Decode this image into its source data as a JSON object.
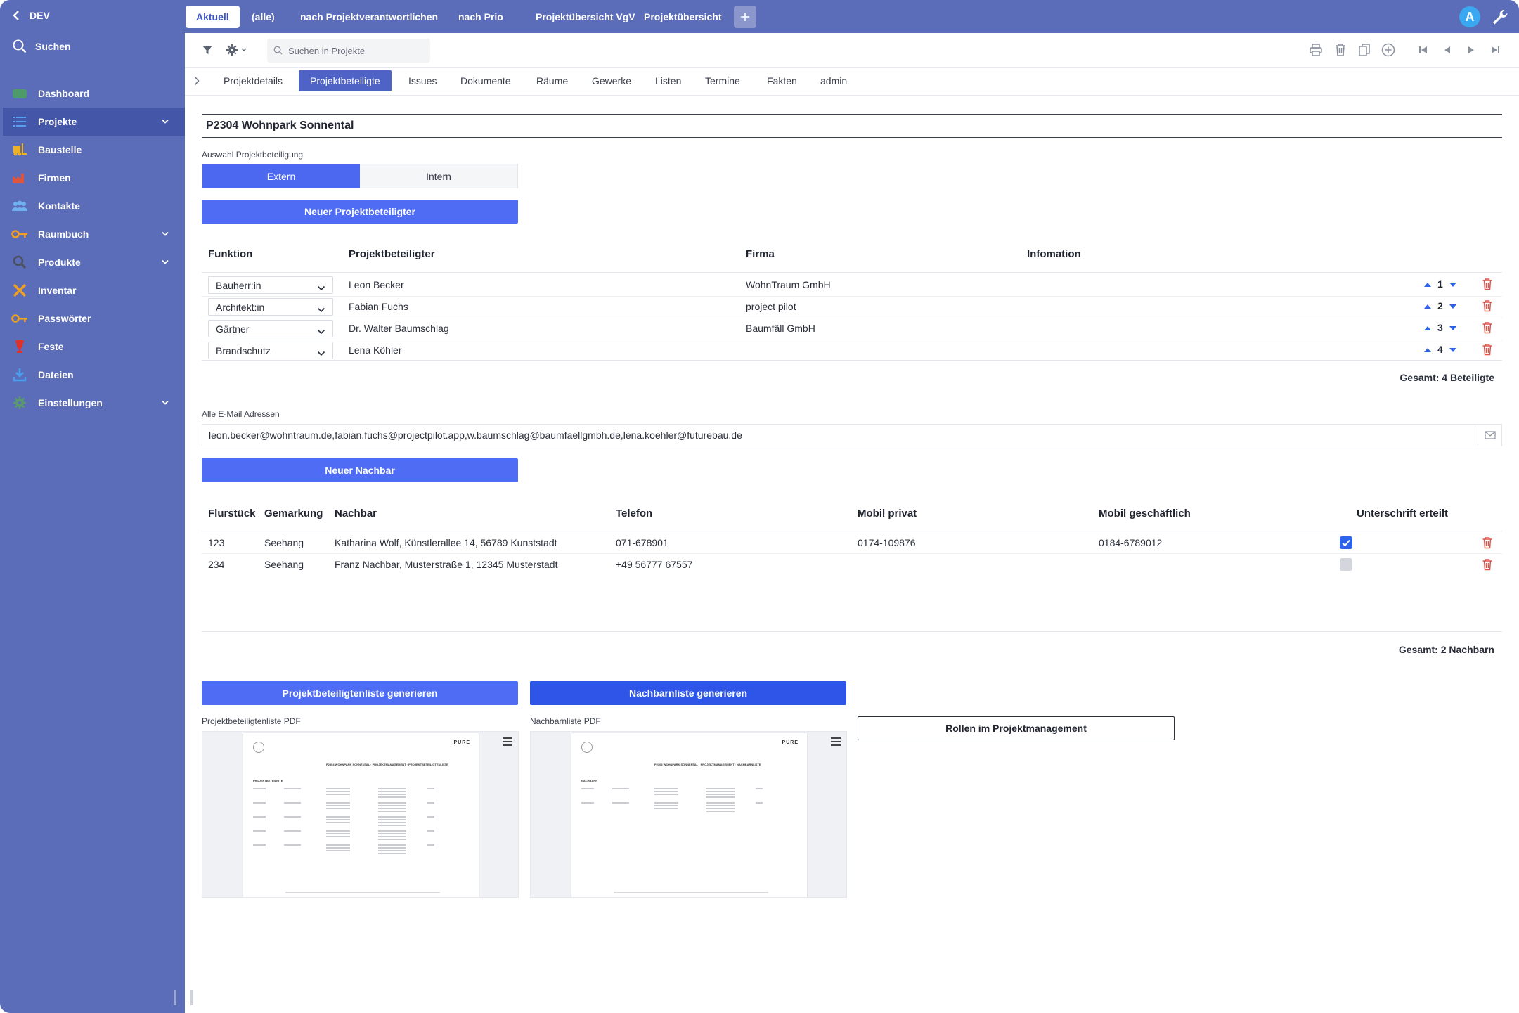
{
  "sidebar": {
    "env_label": "DEV",
    "search_label": "Suchen",
    "items": [
      {
        "label": "Dashboard",
        "icon": "dashboard-icon",
        "color": "#4d9a6a"
      },
      {
        "label": "Projekte",
        "icon": "list-icon",
        "color": "#5aa0f0",
        "active": true,
        "expandable": true
      },
      {
        "label": "Baustelle",
        "icon": "forklift-icon",
        "color": "#f0b020"
      },
      {
        "label": "Firmen",
        "icon": "factory-icon",
        "color": "#e0553a"
      },
      {
        "label": "Kontakte",
        "icon": "people-icon",
        "color": "#6fb0f0"
      },
      {
        "label": "Raumbuch",
        "icon": "key-icon",
        "color": "#f0a020",
        "expandable": true
      },
      {
        "label": "Produkte",
        "icon": "search-icon",
        "color": "#4a5060",
        "expandable": true
      },
      {
        "label": "Inventar",
        "icon": "tools-icon",
        "color": "#f0a020"
      },
      {
        "label": "Passwörter",
        "icon": "key-icon",
        "color": "#f0a020"
      },
      {
        "label": "Feste",
        "icon": "glass-icon",
        "color": "#e0302a"
      },
      {
        "label": "Dateien",
        "icon": "download-icon",
        "color": "#4aa0f0"
      },
      {
        "label": "Einstellungen",
        "icon": "gear-icon",
        "color": "#5a9a6a",
        "expandable": true
      }
    ]
  },
  "topbar": {
    "tabs": [
      {
        "label": "Aktuell",
        "active": true
      },
      {
        "label": "(alle)"
      },
      {
        "label": "nach Projektverantwortlichen"
      },
      {
        "label": "nach Prio"
      },
      {
        "label": "Projektübersicht VgV"
      },
      {
        "label": "Projektübersicht"
      }
    ],
    "add_label": "+",
    "avatar_letter": "A"
  },
  "toolbar": {
    "search_placeholder": "Suchen in Projekte"
  },
  "subtabs": [
    {
      "label": "Projektdetails"
    },
    {
      "label": "Projektbeteiligte",
      "active": true
    },
    {
      "label": "Issues"
    },
    {
      "label": "Dokumente"
    },
    {
      "label": "Räume"
    },
    {
      "label": "Gewerke"
    },
    {
      "label": "Listen"
    },
    {
      "label": "Termine"
    },
    {
      "label": "Fakten"
    },
    {
      "label": "admin"
    }
  ],
  "project": {
    "title": "P2304 Wohnpark Sonnental"
  },
  "beteiligung": {
    "label": "Auswahl Projektbeteiligung",
    "options": [
      "Extern",
      "Intern"
    ],
    "selected": "Extern",
    "new_button": "Neuer Projektbeteiligter",
    "headers": [
      "Funktion",
      "Projektbeteiligter",
      "Firma",
      "Infomation"
    ],
    "rows": [
      {
        "funktion": "Bauherr:in",
        "name": "Leon Becker",
        "firma": "WohnTraum GmbH",
        "order": "1"
      },
      {
        "funktion": "Architekt:in",
        "name": "Fabian Fuchs",
        "firma": "project pilot",
        "order": "2"
      },
      {
        "funktion": "Gärtner",
        "name": "Dr. Walter Baumschlag",
        "firma": "Baumfäll GmbH",
        "order": "3"
      },
      {
        "funktion": "Brandschutz",
        "name": "Lena Köhler",
        "firma": "",
        "order": "4"
      }
    ],
    "total": "Gesamt: 4 Beteiligte"
  },
  "emails": {
    "label": "Alle E-Mail Adressen",
    "value": "leon.becker@wohntraum.de,fabian.fuchs@projectpilot.app,w.baumschlag@baumfaellgmbh.de,lena.koehler@futurebau.de"
  },
  "nachbarn": {
    "new_button": "Neuer Nachbar",
    "headers": [
      "Flurstück",
      "Gemarkung",
      "Nachbar",
      "Telefon",
      "Mobil privat",
      "Mobil geschäftlich",
      "Unterschrift erteilt"
    ],
    "rows": [
      {
        "flurstueck": "123",
        "gemarkung": "Seehang",
        "nachbar": "Katharina Wolf, Künstlerallee 14, 56789 Kunststadt",
        "telefon": "071-678901",
        "mobil_privat": "0174-109876",
        "mobil_geschaeftlich": "0184-6789012",
        "unterschrift": true
      },
      {
        "flurstueck": "234",
        "gemarkung": "Seehang",
        "nachbar": "Franz Nachbar, Musterstraße 1, 12345 Musterstadt",
        "telefon": "+49 56777 67557",
        "mobil_privat": "",
        "mobil_geschaeftlich": "",
        "unterschrift": false
      }
    ],
    "total": "Gesamt: 2 Nachbarn"
  },
  "actions": {
    "gen_beteiligte": "Projektbeteiligtenliste generieren",
    "gen_nachbarn": "Nachbarnliste generieren",
    "rollen": "Rollen im Projektmanagement"
  },
  "pdfs": {
    "beteiligte_label": "Projektbeteiligtenliste PDF",
    "nachbarn_label": "Nachbarnliste PDF",
    "brand": "PURE",
    "beteiligte_heading": "PROJEKTBETEILIGTE",
    "nachbarn_heading": "NACHBARN",
    "beteiligte_title": "P2304 WOHNPARK SONNENTAL · PROJEKTMANAGEMENT · PROJEKTBETEILIGTENLISTE",
    "nachbarn_title": "P2304 WOHNPARK SONNENTAL · PROJEKTMANAGEMENT · NACHBARNLISTE"
  },
  "colors": {
    "sidebar": "#5b6cb9",
    "primary": "#4f6cf5",
    "danger": "#e0554a",
    "order_arrow": "#2d63e8"
  }
}
